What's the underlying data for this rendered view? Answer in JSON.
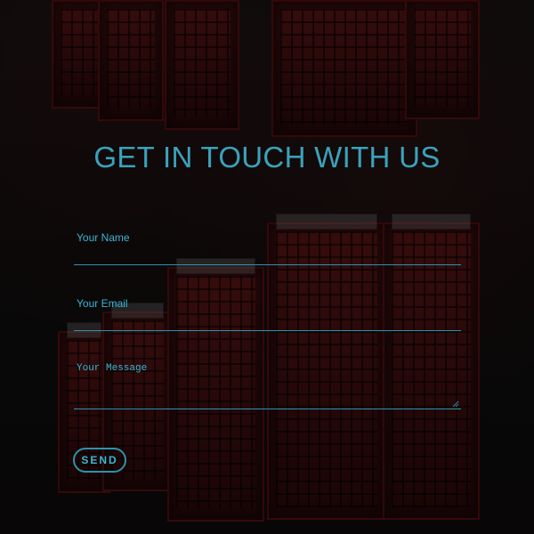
{
  "page": {
    "title": "GET IN TOUCH WITH US"
  },
  "form": {
    "name": {
      "label": "Your Name",
      "value": "",
      "placeholder": ""
    },
    "email": {
      "label": "Your Email",
      "value": "",
      "placeholder": ""
    },
    "message": {
      "label": "Your Message",
      "value": "",
      "placeholder": ""
    },
    "send_label": "SEND"
  },
  "theme": {
    "accent": "#39b7d4",
    "accent_dark": "#2a93ad"
  }
}
